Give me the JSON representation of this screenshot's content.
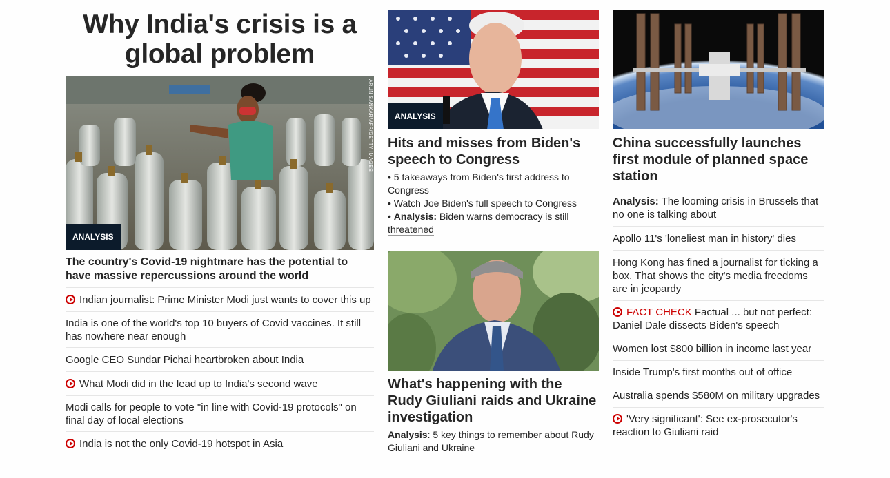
{
  "col1": {
    "title": "Why India's crisis is a global problem",
    "image_badge": "ANALYSIS",
    "image_credit": "ARUN SANKAR/AFP/GETTY IMAGES",
    "headline": "The country's Covid-19 nightmare has the potential to have massive repercussions around the world",
    "items": [
      {
        "video": true,
        "text": "Indian journalist: Prime Minister Modi just wants to cover this up"
      },
      {
        "video": false,
        "text": "India is one of the world's top 10 buyers of Covid vaccines. It still has nowhere near enough"
      },
      {
        "video": false,
        "text": "Google CEO Sundar Pichai heartbroken about India"
      },
      {
        "video": true,
        "text": "What Modi did in the lead up to India's second wave"
      },
      {
        "video": false,
        "text": "Modi calls for people to vote \"in line with Covid-19 protocols\" on final day of local elections"
      },
      {
        "video": true,
        "text": "India is not the only Covid-19 hotspot in Asia"
      }
    ]
  },
  "col2": {
    "story1": {
      "badge": "ANALYSIS",
      "headline": "Hits and misses from Biden's speech to Congress",
      "bullets": [
        {
          "prefix": "• ",
          "bold": "",
          "text": "5 takeaways from Biden's first address to Congress"
        },
        {
          "prefix": "• ",
          "bold": "",
          "text": "Watch Joe Biden's full speech to Congress"
        },
        {
          "prefix": "• ",
          "bold": "Analysis:",
          "text": " Biden warns democracy is still threatened"
        }
      ]
    },
    "story2": {
      "headline": "What's happening with the Rudy Giuliani raids and Ukraine investigation",
      "sub_bold": "Analysis",
      "sub_text": ": 5 key things to remember about Rudy Giuliani and Ukraine"
    }
  },
  "col3": {
    "headline": "China successfully launches first module of planned space station",
    "items": [
      {
        "video": false,
        "bold": "Analysis:",
        "red": "",
        "text": " The looming crisis in Brussels that no one is talking about"
      },
      {
        "video": false,
        "bold": "",
        "red": "",
        "text": "Apollo 11's 'loneliest man in history' dies"
      },
      {
        "video": false,
        "bold": "",
        "red": "",
        "text": "Hong Kong has fined a journalist for ticking a box. That shows the city's media freedoms are in jeopardy"
      },
      {
        "video": true,
        "bold": "",
        "red": "FACT CHECK",
        "text": " Factual ... but not perfect: Daniel Dale dissects Biden's speech"
      },
      {
        "video": false,
        "bold": "",
        "red": "",
        "text": "Women lost $800 billion in income last year"
      },
      {
        "video": false,
        "bold": "",
        "red": "",
        "text": "Inside Trump's first months out of office"
      },
      {
        "video": false,
        "bold": "",
        "red": "",
        "text": "Australia spends $580M on military upgrades"
      },
      {
        "video": true,
        "bold": "",
        "red": "",
        "text": "'Very significant': See ex-prosecutor's reaction to Giuliani raid"
      }
    ]
  },
  "colors": {
    "badge_bg": "#0c1b2b",
    "video_red": "#cc0000",
    "text": "#262626",
    "divider": "#e6e6e6"
  }
}
